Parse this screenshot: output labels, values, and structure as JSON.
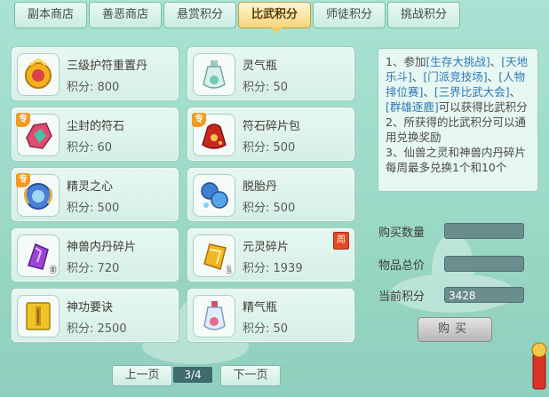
{
  "tabs": [
    {
      "label": "副本商店",
      "active": false
    },
    {
      "label": "善恶商店",
      "active": false
    },
    {
      "label": "悬赏积分",
      "active": false
    },
    {
      "label": "比武积分",
      "active": true
    },
    {
      "label": "师徒积分",
      "active": false
    },
    {
      "label": "挑战积分",
      "active": false
    }
  ],
  "items": [
    {
      "name": "三级护符重置丹",
      "price": "积分: 800",
      "icon": "gold-amulet-icon"
    },
    {
      "name": "灵气瓶",
      "price": "积分: 50",
      "icon": "spirit-bottle-icon"
    },
    {
      "name": "尘封的符石",
      "price": "积分: 60",
      "icon": "rune-stone-icon",
      "tag": "专"
    },
    {
      "name": "符石碎片包",
      "price": "积分: 500",
      "icon": "rune-shard-bag-icon",
      "tag": "专"
    },
    {
      "name": "精灵之心",
      "price": "积分: 500",
      "icon": "spirit-heart-icon",
      "tag": "专"
    },
    {
      "name": "脱胎丹",
      "price": "积分: 500",
      "icon": "rebirth-pill-icon"
    },
    {
      "name": "神兽内丹碎片",
      "price": "积分: 720",
      "icon": "beast-core-shard-icon",
      "count": "9"
    },
    {
      "name": "元灵碎片",
      "price": "积分: 1939",
      "icon": "yuanling-shard-icon",
      "count": "1",
      "week": "周"
    },
    {
      "name": "神功要诀",
      "price": "积分: 2500",
      "icon": "skill-book-icon"
    },
    {
      "name": "精气瓶",
      "price": "积分: 50",
      "icon": "essence-bottle-icon"
    }
  ],
  "info": {
    "line1_a": "1、参加",
    "line1_k1": "[生存大挑战]",
    "line1_b": "、",
    "line1_k2": "[天地乐斗]",
    "line1_c": "、",
    "line1_k3": "[门派竞技场]",
    "line1_d": "、",
    "line1_k4": "[人物排位赛]",
    "line1_e": "、",
    "line1_k5": "[三界比武大会]",
    "line1_f": "、",
    "line1_k6": "[群雄逐鹿]",
    "line1_g": "可以获得比武积分",
    "line2": "2、所获得的比武积分可以通用兑换奖励",
    "line3": "3、仙兽之灵和神兽内丹碎片每周最多兑换1个和10个"
  },
  "form": {
    "qty_label": "购买数量",
    "qty_value": "",
    "total_label": "物品总价",
    "total_value": "",
    "points_label": "当前积分",
    "points_value": "3428",
    "buy_label": "购买"
  },
  "pager": {
    "prev": "上一页",
    "page": "3/4",
    "next": "下一页"
  },
  "colors": {
    "accent": "#f6d57b",
    "keyword": "#2e78b7",
    "tag": "#f29a1e",
    "week": "#e24a2c"
  }
}
